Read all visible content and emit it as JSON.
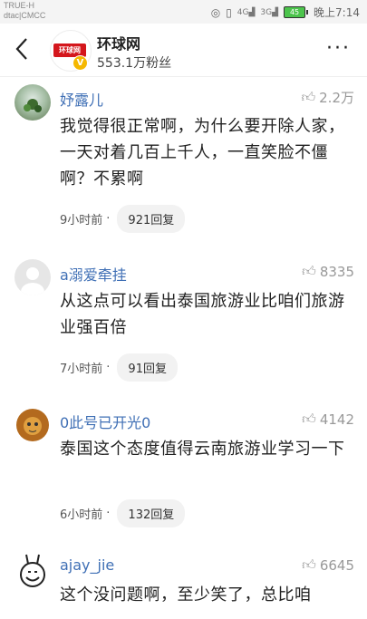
{
  "status_bar": {
    "carrier_line1": "TRUE-H",
    "carrier_line2": "dtac|CMCC",
    "signal1": "4G",
    "signal2": "3G",
    "battery": "45",
    "time": "晚上7:14"
  },
  "header": {
    "account_name": "环球网",
    "followers": "553.1万粉丝",
    "logo_text": "环球网"
  },
  "comments": [
    {
      "user": "妤露儿",
      "likes": "2.2万",
      "text": "我觉得很正常啊，为什么要开除人家，一天对着几百上千人，一直笑脸不僵啊？不累啊",
      "time": "9小时前",
      "replies": "921回复"
    },
    {
      "user": "a溺爱牵挂",
      "likes": "8335",
      "text": "从这点可以看出泰国旅游业比咱们旅游业强百倍",
      "time": "7小时前",
      "replies": "91回复"
    },
    {
      "user": "0此号已开光0",
      "likes": "4142",
      "text": "泰国这个态度值得云南旅游业学习一下",
      "time": "6小时前",
      "replies": "132回复"
    },
    {
      "user": "ajay_jie",
      "likes": "6645",
      "text": "这个没问题啊，至少笑了，总比咱",
      "time": "",
      "replies": ""
    }
  ],
  "dot": "·"
}
